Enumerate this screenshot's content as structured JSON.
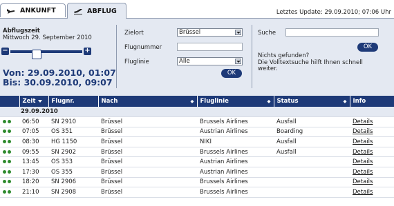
{
  "tabs": [
    {
      "label": "ANKUNFT",
      "icon": "plane-landing-icon"
    },
    {
      "label": "ABFLUG",
      "icon": "plane-takeoff-icon",
      "active": true
    }
  ],
  "last_update": "Letztes Update: 29.09.2010; 07:06 Uhr",
  "filters": {
    "title": "Abflugszeit",
    "date": "Mittwoch 29. September 2010",
    "range_from": "Von: 29.09.2010, 01:07",
    "range_to": "Bis:  30.09.2010, 09:07",
    "destination_label": "Zielort",
    "destination_value": "Brüssel",
    "flight_number_label": "Flugnummer",
    "airline_label": "Fluglinie",
    "airline_value": "Alle",
    "ok_label": "OK",
    "search_label": "Suche",
    "search_ok_label": "OK",
    "hint": "Nichts gefunden?\nDie Volltextsuche hilft Ihnen schnell weiter."
  },
  "table": {
    "headers": [
      "",
      "Zeit",
      "Flugnr.",
      "Nach",
      "Fluglinie",
      "Status",
      "Info"
    ],
    "date_group": "29.09.2010",
    "rows": [
      {
        "time": "06:50",
        "flight": "SN 2910",
        "dest": "Brüssel",
        "airline": "Brussels Airlines",
        "status": "Ausfall",
        "info": "Details"
      },
      {
        "time": "07:05",
        "flight": "OS 351",
        "dest": "Brüssel",
        "airline": "Austrian Airlines",
        "status": "Boarding",
        "info": "Details"
      },
      {
        "time": "08:30",
        "flight": "HG 1150",
        "dest": "Brüssel",
        "airline": "NIKI",
        "status": "Ausfall",
        "info": "Details"
      },
      {
        "time": "09:55",
        "flight": "SN 2902",
        "dest": "Brüssel",
        "airline": "Brussels Airlines",
        "status": "Ausfall",
        "info": "Details"
      },
      {
        "time": "13:45",
        "flight": "OS 353",
        "dest": "Brüssel",
        "airline": "Austrian Airlines",
        "status": "",
        "info": "Details"
      },
      {
        "time": "17:30",
        "flight": "OS 355",
        "dest": "Brüssel",
        "airline": "Austrian Airlines",
        "status": "",
        "info": "Details"
      },
      {
        "time": "18:20",
        "flight": "SN 2906",
        "dest": "Brüssel",
        "airline": "Brussels Airlines",
        "status": "",
        "info": "Details"
      },
      {
        "time": "21:10",
        "flight": "SN 2908",
        "dest": "Brüssel",
        "airline": "Brussels Airlines",
        "status": "",
        "info": "Details"
      }
    ]
  },
  "colors": {
    "accent": "#1e3a78",
    "panel": "#e4e9f2",
    "dot": "#2d8a2d"
  }
}
